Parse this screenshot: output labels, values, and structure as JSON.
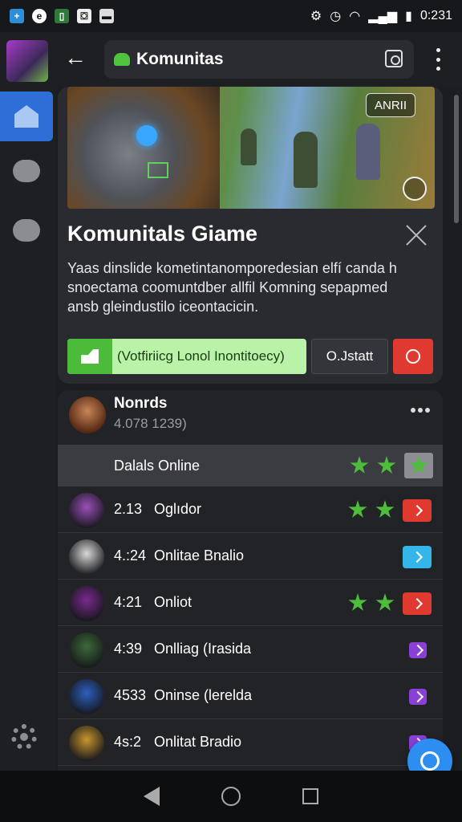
{
  "status_bar": {
    "time": "0:231"
  },
  "header": {
    "title": "Komunitas"
  },
  "feature_card": {
    "banner_tag": "ANRII",
    "title": "Komunitals Giame",
    "description": "Yaas dinslide kometintanomporedesian elfí canda h snoectama coomuntdber allfil Komning sepapmed ansb gleindustilo iceontacicin.",
    "primary_action": "(Votfiriicg Lonol Inontitoecy)",
    "secondary_action": "O.Jstatt"
  },
  "panel": {
    "name": "Nonrds",
    "count": "4.078 1239)",
    "online_label": "Dalals Online",
    "rows": [
      {
        "time": "2.13",
        "name": "Oglıdor",
        "avatar": "#9a4fb8",
        "stars": 2,
        "badge_color": "#e0392f"
      },
      {
        "time": "4.:24",
        "name": "Onlitae Bnalio",
        "avatar": "#d8d8d8",
        "stars": 0,
        "badge_color": "#35b6ea"
      },
      {
        "time": "4:21",
        "name": "Onliot",
        "avatar": "#7a2a8e",
        "stars": 2,
        "badge_color": "#e0392f"
      },
      {
        "time": "4:39",
        "name": "Onlliag (Irasida",
        "avatar": "#3d6a3a",
        "stars": 0,
        "badge_color": "#8a3fd6"
      },
      {
        "time": "4533",
        "name": "Oninse (lerelda",
        "avatar": "#2d5fbf",
        "stars": 0,
        "badge_color": "#8a3fd6"
      },
      {
        "time": "4s:2",
        "name": "Onlitat Bradio",
        "avatar": "#c8952e",
        "stars": 0,
        "badge_color": "#8a3fd6"
      }
    ]
  }
}
